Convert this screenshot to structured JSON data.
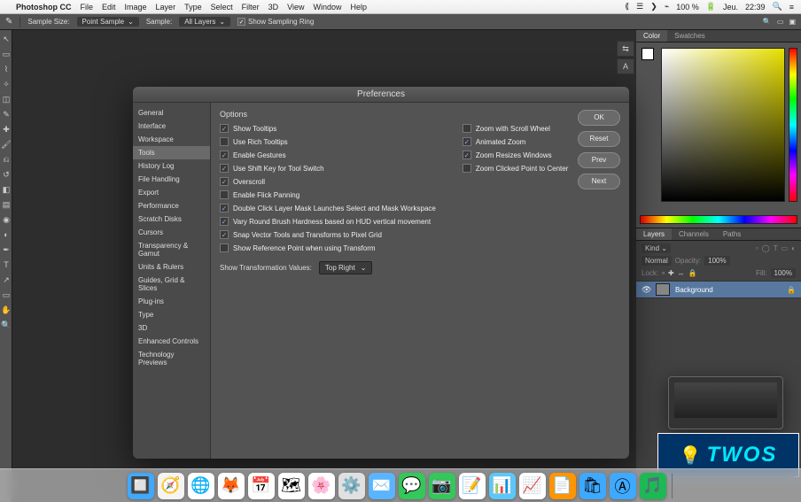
{
  "menubar": {
    "apple": "",
    "app": "Photoshop CC",
    "items": [
      "File",
      "Edit",
      "Image",
      "Layer",
      "Type",
      "Select",
      "Filter",
      "3D",
      "View",
      "Window",
      "Help"
    ],
    "right": {
      "icons": [
        "⟪",
        "☰",
        "❯",
        "⌁"
      ],
      "battery": "100 %",
      "battery_icon": "🔋",
      "day": "Jeu.",
      "time": "22:39",
      "search": "🔍",
      "menu": "≡"
    }
  },
  "options_bar": {
    "tool_icon": "✎",
    "sample_size_label": "Sample Size:",
    "sample_size_value": "Point Sample",
    "sample_label": "Sample:",
    "sample_value": "All Layers",
    "show_sampling_ring": "Show Sampling Ring",
    "checked": true
  },
  "collapsed_dock": [
    "⇆",
    "A"
  ],
  "panels": {
    "color": {
      "tabs": [
        "Color",
        "Swatches"
      ],
      "active": 0
    },
    "layers": {
      "tabs": [
        "Layers",
        "Channels",
        "Paths"
      ],
      "active": 0,
      "kind_label": "Kind",
      "filter_icons": [
        "▫",
        "◯",
        "T",
        "▭",
        "◐"
      ],
      "blend_mode": "Normal",
      "opacity_label": "Opacity:",
      "opacity_value": "100%",
      "lock_label": "Lock:",
      "lock_icons": [
        "▫",
        "✚",
        "↔",
        "⬓",
        "🔒"
      ],
      "fill_label": "Fill:",
      "fill_value": "100%",
      "layer": {
        "name": "Background",
        "visible": "👁"
      }
    }
  },
  "prefs": {
    "title": "Preferences",
    "sidebar": [
      "General",
      "Interface",
      "Workspace",
      "Tools",
      "History Log",
      "File Handling",
      "Export",
      "Performance",
      "Scratch Disks",
      "Cursors",
      "Transparency & Gamut",
      "Units & Rulers",
      "Guides, Grid & Slices",
      "Plug-ins",
      "Type",
      "3D",
      "Enhanced Controls",
      "Technology Previews"
    ],
    "selected": 3,
    "section_title": "Options",
    "left_opts": [
      {
        "label": "Show Tooltips",
        "checked": true
      },
      {
        "label": "Use Rich Tooltips",
        "checked": false
      },
      {
        "label": "Enable Gestures",
        "checked": true
      },
      {
        "label": "Use Shift Key for Tool Switch",
        "checked": true
      },
      {
        "label": "Overscroll",
        "checked": true
      },
      {
        "label": "Enable Flick Panning",
        "checked": false
      },
      {
        "label": "Double Click Layer Mask Launches Select and Mask Workspace",
        "checked": true
      },
      {
        "label": "Vary Round Brush Hardness based on HUD vertical movement",
        "checked": true
      },
      {
        "label": "Snap Vector Tools and Transforms to Pixel Grid",
        "checked": true
      },
      {
        "label": "Show Reference Point when using Transform",
        "checked": false
      }
    ],
    "right_opts": [
      {
        "label": "Zoom with Scroll Wheel",
        "checked": false
      },
      {
        "label": "Animated Zoom",
        "checked": true
      },
      {
        "label": "Zoom Resizes Windows",
        "checked": true
      },
      {
        "label": "Zoom Clicked Point to Center",
        "checked": false
      }
    ],
    "transform_label": "Show Transformation Values:",
    "transform_value": "Top Right",
    "buttons": {
      "ok": "OK",
      "reset": "Reset",
      "prev": "Prev",
      "next": "Next"
    }
  },
  "watermark": {
    "text": "TWOS",
    "bulb": "💡"
  },
  "dock": [
    {
      "name": "finder",
      "emoji": "🔲",
      "bg": "#3fa9ff"
    },
    {
      "name": "safari",
      "emoji": "🧭",
      "bg": "#f4f4f4"
    },
    {
      "name": "chrome",
      "emoji": "🌐",
      "bg": "#fff"
    },
    {
      "name": "firefox",
      "emoji": "🦊",
      "bg": "#fff"
    },
    {
      "name": "calendar",
      "emoji": "📅",
      "bg": "#fff"
    },
    {
      "name": "maps",
      "emoji": "🗺",
      "bg": "#fff"
    },
    {
      "name": "photos",
      "emoji": "🌸",
      "bg": "#fff"
    },
    {
      "name": "settings",
      "emoji": "⚙️",
      "bg": "#e0e0e0"
    },
    {
      "name": "mail",
      "emoji": "✉️",
      "bg": "#5bb4ff"
    },
    {
      "name": "messages",
      "emoji": "💬",
      "bg": "#34c759"
    },
    {
      "name": "facetime",
      "emoji": "📷",
      "bg": "#34c759"
    },
    {
      "name": "notes",
      "emoji": "📝",
      "bg": "#fff"
    },
    {
      "name": "keynote",
      "emoji": "📊",
      "bg": "#5ac8fa"
    },
    {
      "name": "numbers",
      "emoji": "📈",
      "bg": "#fff"
    },
    {
      "name": "pages",
      "emoji": "📄",
      "bg": "#ff9500"
    },
    {
      "name": "appstore",
      "emoji": "🛍",
      "bg": "#3fa9ff"
    },
    {
      "name": "appstore2",
      "emoji": "Ⓐ",
      "bg": "#3fa9ff"
    },
    {
      "name": "spotify",
      "emoji": "🎵",
      "bg": "#1db954"
    }
  ]
}
